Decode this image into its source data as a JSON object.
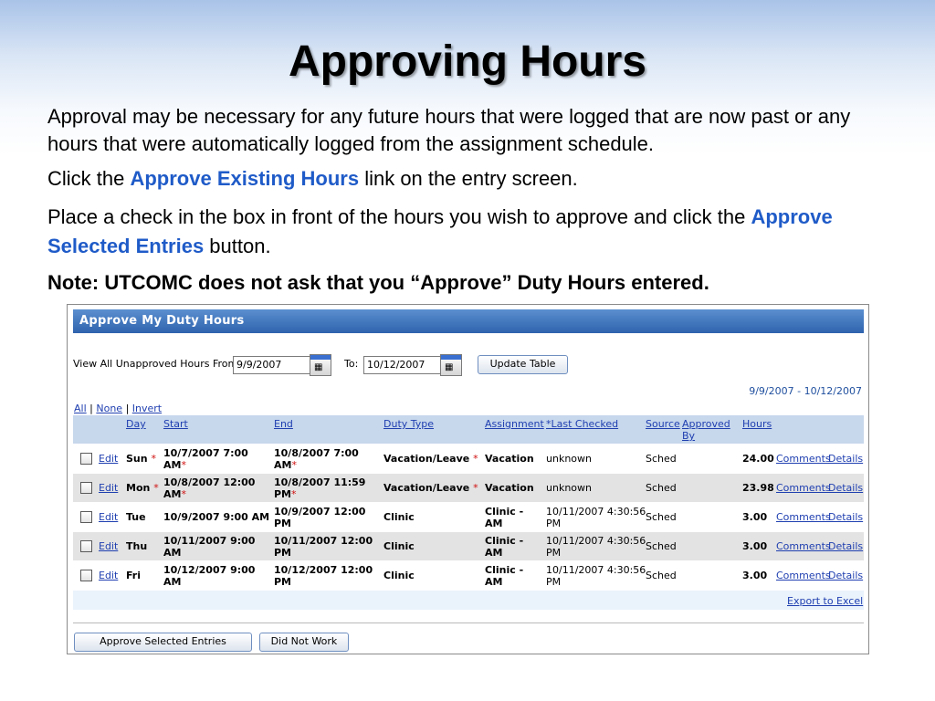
{
  "slide": {
    "title": "Approving Hours",
    "intro": "Approval may be necessary for any future hours that were logged  that are now past or any hours that were automatically logged from the assignment schedule.",
    "bullet1": {
      "pre": "Click the ",
      "link": "Approve Existing Hours",
      "post": " link on the entry screen."
    },
    "bullet2": {
      "pre": "Place a check in the box in front of the hours you wish to approve and click the ",
      "link": "Approve Selected Entries",
      "post": " button."
    },
    "bullet3": "Note:  UTCOMC does not ask that you “Approve” Duty Hours entered.",
    "bullet_mark": ""
  },
  "panel": {
    "header": "Approve My Duty Hours",
    "view_label": "View All Unapproved Hours From:",
    "from_value": "9/9/2007",
    "to_label": "To:",
    "to_value": "10/12/2007",
    "update_button": "Update Table",
    "range_text": "9/9/2007 - 10/12/2007",
    "links": {
      "all": "All",
      "sep": "|",
      "none": "None",
      "invert": "Invert"
    },
    "columns": {
      "day": "Day",
      "start": "Start",
      "end": "End",
      "duty_type": "Duty Type",
      "assignment": "Assignment",
      "last_checked": "*Last Checked",
      "source": "Source",
      "approved_by_1": "Approved",
      "approved_by_2": "By",
      "hours": "Hours"
    },
    "rows": [
      {
        "edit": "Edit",
        "day": "Sun",
        "day_req": "*",
        "start1": "10/7/2007 7:00",
        "start2": "AM",
        "start_req": "*",
        "end1": "10/8/2007 7:00",
        "end2": "AM",
        "end_req": "*",
        "duty_type": "Vacation/Leave",
        "duty_req": "*",
        "assign1": "Vacation",
        "assign2": "",
        "checked1": "unknown",
        "checked2": "",
        "source": "Sched",
        "hours": "24.00",
        "comments": "Comments",
        "details": "Details"
      },
      {
        "edit": "Edit",
        "day": "Mon",
        "day_req": "*",
        "start1": "10/8/2007 12:00",
        "start2": "AM",
        "start_req": "*",
        "end1": "10/8/2007 11:59",
        "end2": "PM",
        "end_req": "*",
        "duty_type": "Vacation/Leave",
        "duty_req": "*",
        "assign1": "Vacation",
        "assign2": "",
        "checked1": "unknown",
        "checked2": "",
        "source": "Sched",
        "hours": "23.98",
        "comments": "Comments",
        "details": "Details"
      },
      {
        "edit": "Edit",
        "day": "Tue",
        "day_req": "",
        "start1": "10/9/2007 9:00 AM",
        "start2": "",
        "start_req": "",
        "end1": "10/9/2007 12:00",
        "end2": "PM",
        "end_req": "",
        "duty_type": "Clinic",
        "duty_req": "",
        "assign1": "Clinic -",
        "assign2": "AM",
        "checked1": "10/11/2007 4:30:56",
        "checked2": "PM",
        "source": "Sched",
        "hours": "3.00",
        "comments": "Comments",
        "details": "Details"
      },
      {
        "edit": "Edit",
        "day": "Thu",
        "day_req": "",
        "start1": "10/11/2007 9:00",
        "start2": "AM",
        "start_req": "",
        "end1": "10/11/2007 12:00",
        "end2": "PM",
        "end_req": "",
        "duty_type": "Clinic",
        "duty_req": "",
        "assign1": "Clinic -",
        "assign2": "AM",
        "checked1": "10/11/2007 4:30:56",
        "checked2": "PM",
        "source": "Sched",
        "hours": "3.00",
        "comments": "Comments",
        "details": "Details"
      },
      {
        "edit": "Edit",
        "day": "Fri",
        "day_req": "",
        "start1": "10/12/2007 9:00",
        "start2": "AM",
        "start_req": "",
        "end1": "10/12/2007 12:00",
        "end2": "PM",
        "end_req": "",
        "duty_type": "Clinic",
        "duty_req": "",
        "assign1": "Clinic -",
        "assign2": "AM",
        "checked1": "10/11/2007 4:30:56",
        "checked2": "PM",
        "source": "Sched",
        "hours": "3.00",
        "comments": "Comments",
        "details": "Details"
      }
    ],
    "export_link": "Export to Excel",
    "approve_button": "Approve Selected Entries",
    "did_not_work_button": "Did Not Work"
  }
}
